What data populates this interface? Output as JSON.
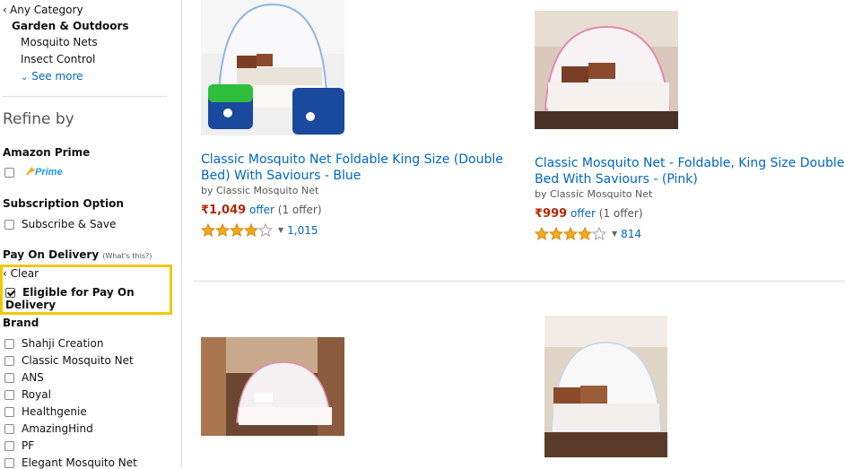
{
  "sidebar": {
    "any_category": "Any Category",
    "category_head": "Garden & Outdoors",
    "categories": [
      "Mosquito Nets",
      "Insect Control"
    ],
    "see_more": "See more",
    "refine_by": "Refine by",
    "amazon_prime_title": "Amazon Prime",
    "prime_logo": "Prime",
    "subscription_title": "Subscription Option",
    "subscribe_save": "Subscribe & Save",
    "pod_title": "Pay On Delivery",
    "pod_note": "(What's this?)",
    "clear": "Clear",
    "pod_option": "Eligible for Pay On Delivery",
    "pod_checked": true,
    "brand_title": "Brand",
    "brands": [
      "Shahji Creation",
      "Classic Mosquito Net",
      "ANS",
      "Royal",
      "Healthgenie",
      "AmazingHind",
      "PF",
      "Elegant Mosquito Net"
    ]
  },
  "products": [
    {
      "title_line1": "Classic Mosquito Net Foldable King Size (Double",
      "title_line2": "Bed) With Saviours - Blue",
      "by": "by Classic Mosquito Net",
      "price": "₹1,049",
      "offer": "offer",
      "offer_count": "(1 offer)",
      "rating": 4,
      "reviews": "1,015"
    },
    {
      "title_line1": "Classic Mosquito Net - Foldable, King Size Double",
      "title_line2": "Bed With Saviours - (Pink)",
      "by": "by Classic Mosquito Net",
      "price": "₹999",
      "offer": "offer",
      "offer_count": "(1 offer)",
      "rating": 4,
      "reviews": "814"
    }
  ],
  "colors": {
    "link": "#0066c0",
    "price": "#b12704",
    "highlight": "#f0c808",
    "star": "#f4a81d"
  },
  "icons": {
    "back": "chevron-left-icon",
    "see_more": "double-chevron-down-icon",
    "star": "star-icon"
  }
}
